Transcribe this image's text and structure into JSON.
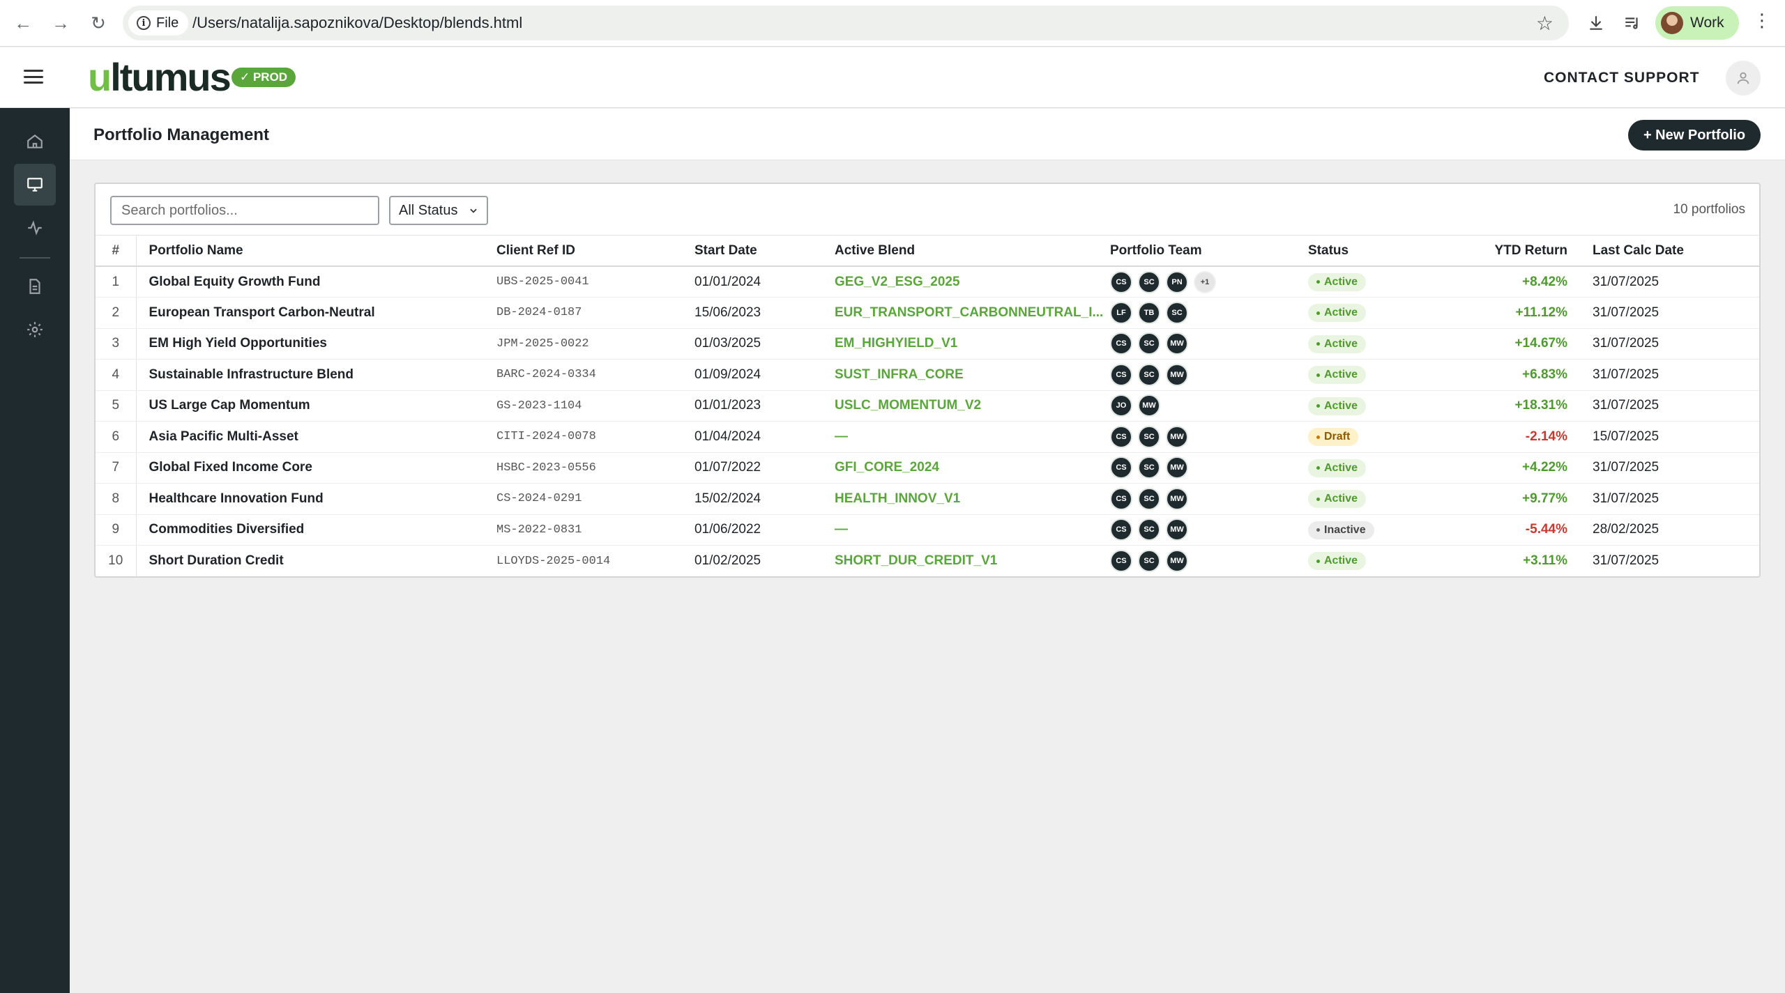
{
  "browser": {
    "file_label": "File",
    "url": "/Users/natalija.sapoznikova/Desktop/blends.html",
    "profile_label": "Work"
  },
  "header": {
    "logo_text": "ultumus",
    "env_badge": "✓ PROD",
    "contact_label": "CONTACT SUPPORT"
  },
  "sidebar": {
    "items": [
      {
        "name": "home-icon"
      },
      {
        "name": "monitor-icon",
        "active": true
      },
      {
        "name": "activity-icon"
      },
      {
        "name": "document-icon"
      },
      {
        "name": "gear-icon"
      }
    ]
  },
  "page": {
    "title": "Portfolio Management",
    "new_button": "+ New Portfolio"
  },
  "toolbar": {
    "search_placeholder": "Search portfolios...",
    "status_filter": "All Status",
    "count_label": "10 portfolios"
  },
  "table": {
    "columns": [
      "#",
      "Portfolio Name",
      "Client Ref ID",
      "Start Date",
      "Active Blend",
      "Portfolio Team",
      "Status",
      "YTD Return",
      "Last Calc Date"
    ],
    "rows": [
      {
        "idx": "1",
        "name": "Global Equity Growth Fund",
        "ref": "UBS-2025-0041",
        "start": "01/01/2024",
        "blend": "GEG_V2_ESG_2025",
        "team": [
          "CS",
          "SC",
          "PN"
        ],
        "more": "+1",
        "status": "Active",
        "ytd": "+8.42%",
        "calc": "31/07/2025"
      },
      {
        "idx": "2",
        "name": "European Transport Carbon-Neutral",
        "ref": "DB-2024-0187",
        "start": "15/06/2023",
        "blend": "EUR_TRANSPORT_CARBONNEUTRAL_I...",
        "team": [
          "LF",
          "TB",
          "SC"
        ],
        "more": "",
        "status": "Active",
        "ytd": "+11.12%",
        "calc": "31/07/2025"
      },
      {
        "idx": "3",
        "name": "EM High Yield Opportunities",
        "ref": "JPM-2025-0022",
        "start": "01/03/2025",
        "blend": "EM_HIGHYIELD_V1",
        "team": [
          "CS",
          "SC",
          "MW"
        ],
        "more": "",
        "status": "Active",
        "ytd": "+14.67%",
        "calc": "31/07/2025"
      },
      {
        "idx": "4",
        "name": "Sustainable Infrastructure Blend",
        "ref": "BARC-2024-0334",
        "start": "01/09/2024",
        "blend": "SUST_INFRA_CORE",
        "team": [
          "CS",
          "SC",
          "MW"
        ],
        "more": "",
        "status": "Active",
        "ytd": "+6.83%",
        "calc": "31/07/2025"
      },
      {
        "idx": "5",
        "name": "US Large Cap Momentum",
        "ref": "GS-2023-1104",
        "start": "01/01/2023",
        "blend": "USLC_MOMENTUM_V2",
        "team": [
          "JO",
          "MW"
        ],
        "more": "",
        "status": "Active",
        "ytd": "+18.31%",
        "calc": "31/07/2025"
      },
      {
        "idx": "6",
        "name": "Asia Pacific Multi-Asset",
        "ref": "CITI-2024-0078",
        "start": "01/04/2024",
        "blend": "—",
        "team": [
          "CS",
          "SC",
          "MW"
        ],
        "more": "",
        "status": "Draft",
        "ytd": "-2.14%",
        "calc": "15/07/2025"
      },
      {
        "idx": "7",
        "name": "Global Fixed Income Core",
        "ref": "HSBC-2023-0556",
        "start": "01/07/2022",
        "blend": "GFI_CORE_2024",
        "team": [
          "CS",
          "SC",
          "MW"
        ],
        "more": "",
        "status": "Active",
        "ytd": "+4.22%",
        "calc": "31/07/2025"
      },
      {
        "idx": "8",
        "name": "Healthcare Innovation Fund",
        "ref": "CS-2024-0291",
        "start": "15/02/2024",
        "blend": "HEALTH_INNOV_V1",
        "team": [
          "CS",
          "SC",
          "MW"
        ],
        "more": "",
        "status": "Active",
        "ytd": "+9.77%",
        "calc": "31/07/2025"
      },
      {
        "idx": "9",
        "name": "Commodities Diversified",
        "ref": "MS-2022-0831",
        "start": "01/06/2022",
        "blend": "—",
        "team": [
          "CS",
          "SC",
          "MW"
        ],
        "more": "",
        "status": "Inactive",
        "ytd": "-5.44%",
        "calc": "28/02/2025"
      },
      {
        "idx": "10",
        "name": "Short Duration Credit",
        "ref": "LLOYDS-2025-0014",
        "start": "01/02/2025",
        "blend": "SHORT_DUR_CREDIT_V1",
        "team": [
          "CS",
          "SC",
          "MW"
        ],
        "more": "",
        "status": "Active",
        "ytd": "+3.11%",
        "calc": "31/07/2025"
      }
    ]
  },
  "colors": {
    "accent_green": "#5aa63a",
    "negative_red": "#c63a32",
    "sidebar_dark": "#1f2a2e"
  }
}
